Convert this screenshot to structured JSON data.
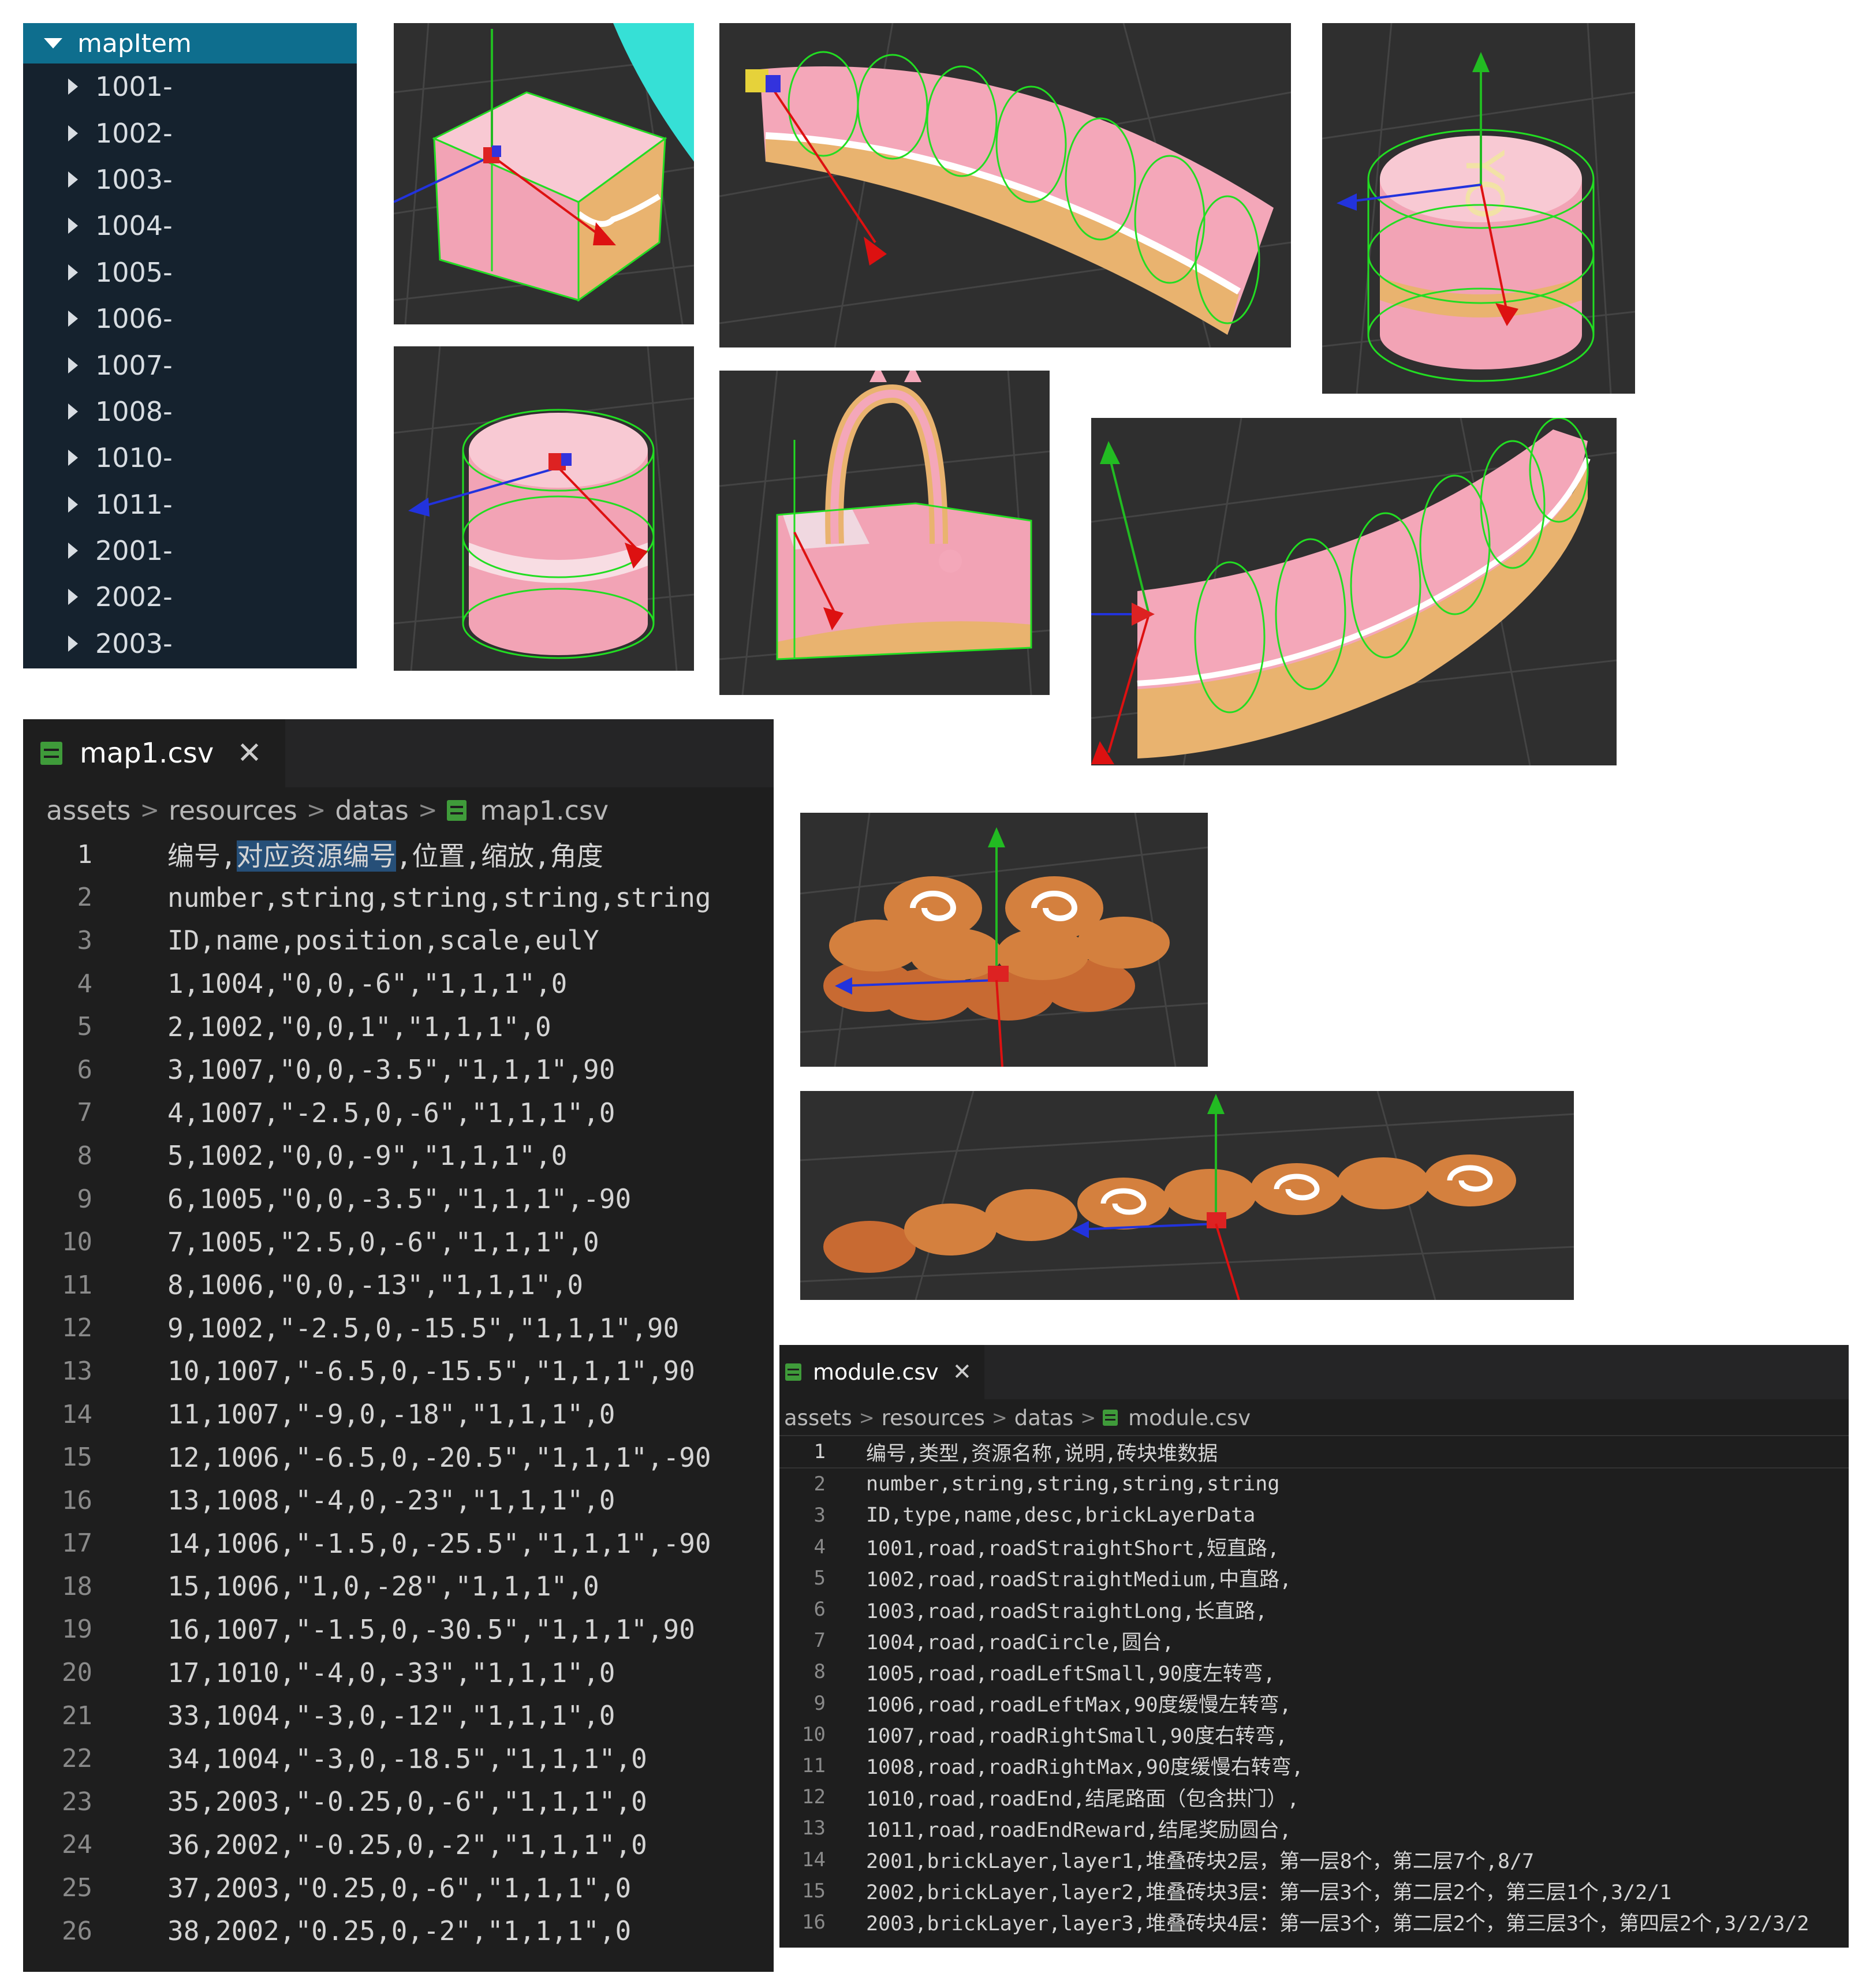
{
  "tree": {
    "root_label": "mapItem",
    "items": [
      "1001-",
      "1002-",
      "1003-",
      "1004-",
      "1005-",
      "1006-",
      "1007-",
      "1008-",
      "1010-",
      "1011-",
      "2001-",
      "2002-",
      "2003-"
    ]
  },
  "viewports": [
    {
      "name": "viewport-cube-cake",
      "subject": "square cake block with transform gizmo"
    },
    {
      "name": "viewport-curved-road",
      "subject": "curved cake road segment with collider rings"
    },
    {
      "name": "viewport-round-cake",
      "subject": "round cake with lettering on top"
    },
    {
      "name": "viewport-round-cake-2",
      "subject": "round cake platform with gizmo"
    },
    {
      "name": "viewport-end-gate",
      "subject": "road end with arch gate"
    },
    {
      "name": "viewport-curved-road-2",
      "subject": "long curved cake road"
    },
    {
      "name": "viewport-brick-layers",
      "subject": "stacked swiss roll bricks"
    },
    {
      "name": "viewport-brick-row",
      "subject": "row of swiss roll bricks"
    }
  ],
  "map_editor": {
    "tab_label": "map1.csv",
    "close_icon": "close-icon",
    "breadcrumb": [
      "assets",
      "resources",
      "datas",
      "map1.csv"
    ],
    "lines": [
      {
        "pre": "编号,",
        "sel": "对应资源编号",
        "post": ",位置,缩放,角度"
      },
      {
        "pre": "number,string,string,string,string"
      },
      {
        "pre": "ID,name,position,scale,eulY"
      },
      {
        "pre": "1,1004,\"0,0,-6\",\"1,1,1\",0"
      },
      {
        "pre": "2,1002,\"0,0,1\",\"1,1,1\",0"
      },
      {
        "pre": "3,1007,\"0,0,-3.5\",\"1,1,1\",90"
      },
      {
        "pre": "4,1007,\"-2.5,0,-6\",\"1,1,1\",0"
      },
      {
        "pre": "5,1002,\"0,0,-9\",\"1,1,1\",0"
      },
      {
        "pre": "6,1005,\"0,0,-3.5\",\"1,1,1\",-90"
      },
      {
        "pre": "7,1005,\"2.5,0,-6\",\"1,1,1\",0"
      },
      {
        "pre": "8,1006,\"0,0,-13\",\"1,1,1\",0"
      },
      {
        "pre": "9,1002,\"-2.5,0,-15.5\",\"1,1,1\",90"
      },
      {
        "pre": "10,1007,\"-6.5,0,-15.5\",\"1,1,1\",90"
      },
      {
        "pre": "11,1007,\"-9,0,-18\",\"1,1,1\",0"
      },
      {
        "pre": "12,1006,\"-6.5,0,-20.5\",\"1,1,1\",-90"
      },
      {
        "pre": "13,1008,\"-4,0,-23\",\"1,1,1\",0"
      },
      {
        "pre": "14,1006,\"-1.5,0,-25.5\",\"1,1,1\",-90"
      },
      {
        "pre": "15,1006,\"1,0,-28\",\"1,1,1\",0"
      },
      {
        "pre": "16,1007,\"-1.5,0,-30.5\",\"1,1,1\",90"
      },
      {
        "pre": "17,1010,\"-4,0,-33\",\"1,1,1\",0"
      },
      {
        "pre": "33,1004,\"-3,0,-12\",\"1,1,1\",0"
      },
      {
        "pre": "34,1004,\"-3,0,-18.5\",\"1,1,1\",0"
      },
      {
        "pre": "35,2003,\"-0.25,0,-6\",\"1,1,1\",0"
      },
      {
        "pre": "36,2002,\"-0.25,0,-2\",\"1,1,1\",0"
      },
      {
        "pre": "37,2003,\"0.25,0,-6\",\"1,1,1\",0"
      },
      {
        "pre": "38,2002,\"0.25,0,-2\",\"1,1,1\",0"
      }
    ]
  },
  "module_editor": {
    "tab_label": "module.csv",
    "close_icon": "close-icon",
    "breadcrumb": [
      "assets",
      "resources",
      "datas",
      "module.csv"
    ],
    "lines": [
      "编号,类型,资源名称,说明,砖块堆数据",
      "number,string,string,string,string",
      "ID,type,name,desc,brickLayerData",
      "1001,road,roadStraightShort,短直路,",
      "1002,road,roadStraightMedium,中直路,",
      "1003,road,roadStraightLong,长直路,",
      "1004,road,roadCircle,圆台,",
      "1005,road,roadLeftSmall,90度左转弯,",
      "1006,road,roadLeftMax,90度缓慢左转弯,",
      "1007,road,roadRightSmall,90度右转弯,",
      "1008,road,roadRightMax,90度缓慢右转弯,",
      "1010,road,roadEnd,结尾路面（包含拱门）,",
      "1011,road,roadEndReward,结尾奖励圆台,",
      "2001,brickLayer,layer1,堆叠砖块2层，第一层8个，第二层7个,8/7",
      "2002,brickLayer,layer2,堆叠砖块3层：第一层3个，第二层2个，第三层1个,3/2/1",
      "2003,brickLayer,layer3,堆叠砖块4层：第一层3个，第二层2个，第三层3个，第四层2个,3/2/3/2"
    ]
  },
  "colors": {
    "tree_bg": "#15222e",
    "tree_header": "#0e6e8e",
    "editor_bg": "#1e1e1e",
    "viewport_bg": "#2f2f2f",
    "collider": "#22dd22",
    "cake_pink": "#f4a7b9",
    "sponge": "#e9b36f"
  }
}
